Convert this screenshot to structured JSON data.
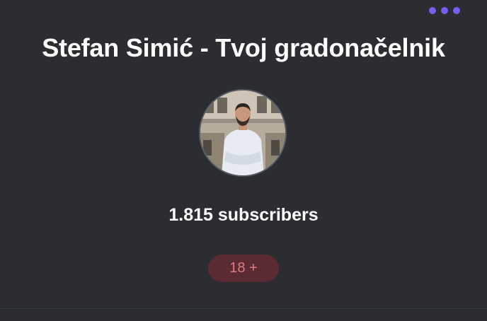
{
  "header": {
    "menu_icon": "more-horizontal-icon",
    "accent_color": "#7b5cf0"
  },
  "channel": {
    "title": "Stefan Simić - Tvoj gradonačelnik",
    "subscribers": "1.815 subscribers",
    "age_badge": "18 +",
    "age_badge_bg": "#5a2b33",
    "age_badge_fg": "#e07a80"
  }
}
